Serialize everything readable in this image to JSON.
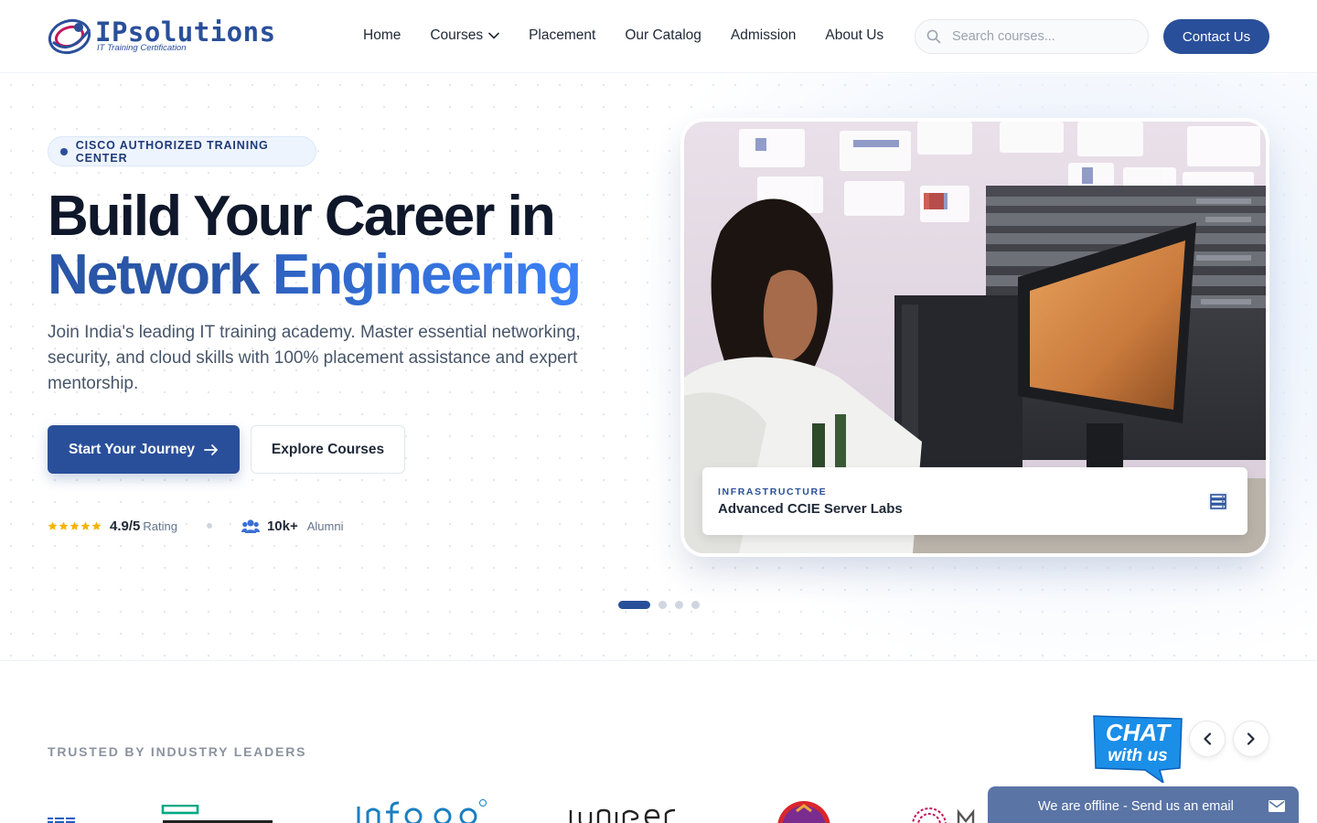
{
  "header": {
    "brand_name": "IPsolutions",
    "brand_tagline": "IT Training Certification",
    "nav": [
      {
        "label": "Home"
      },
      {
        "label": "Courses",
        "has_dropdown": true
      },
      {
        "label": "Placement"
      },
      {
        "label": "Our Catalog"
      },
      {
        "label": "Admission"
      },
      {
        "label": "About Us"
      }
    ],
    "search_placeholder": "Search courses...",
    "contact_label": "Contact Us"
  },
  "hero": {
    "badge": "CISCO AUTHORIZED TRAINING CENTER",
    "title_line1": "Build Your Career in",
    "title_word_a": "Network",
    "title_word_b": "Engineering",
    "lead": "Join India's leading IT training academy. Master essential networking, security, and cloud skills with 100% placement assistance and expert mentorship.",
    "primary_cta": "Start Your Journey",
    "secondary_cta": "Explore Courses",
    "rating_value": "4.9/5",
    "rating_label": "Rating",
    "rating_stars": 5,
    "alumni_value": "10k+",
    "alumni_label": "Alumni",
    "card": {
      "kicker": "INFRASTRUCTURE",
      "title": "Advanced CCIE Server Labs"
    },
    "slides_total": 4,
    "slide_active": 1
  },
  "trusted": {
    "title": "TRUSTED BY INDUSTRY LEADERS",
    "partners": [
      "IBM",
      "Hewlett Packard Enterprise",
      "Infosys",
      "Juniper",
      "Kotak",
      "Microsoft"
    ]
  },
  "chat": {
    "badge_line1": "CHAT",
    "badge_line2": "with us",
    "offline_text": "We are offline - Send us an email"
  },
  "colors": {
    "brand": "#2a4f9a",
    "accent": "#3b82f6",
    "star": "#f5b301"
  }
}
